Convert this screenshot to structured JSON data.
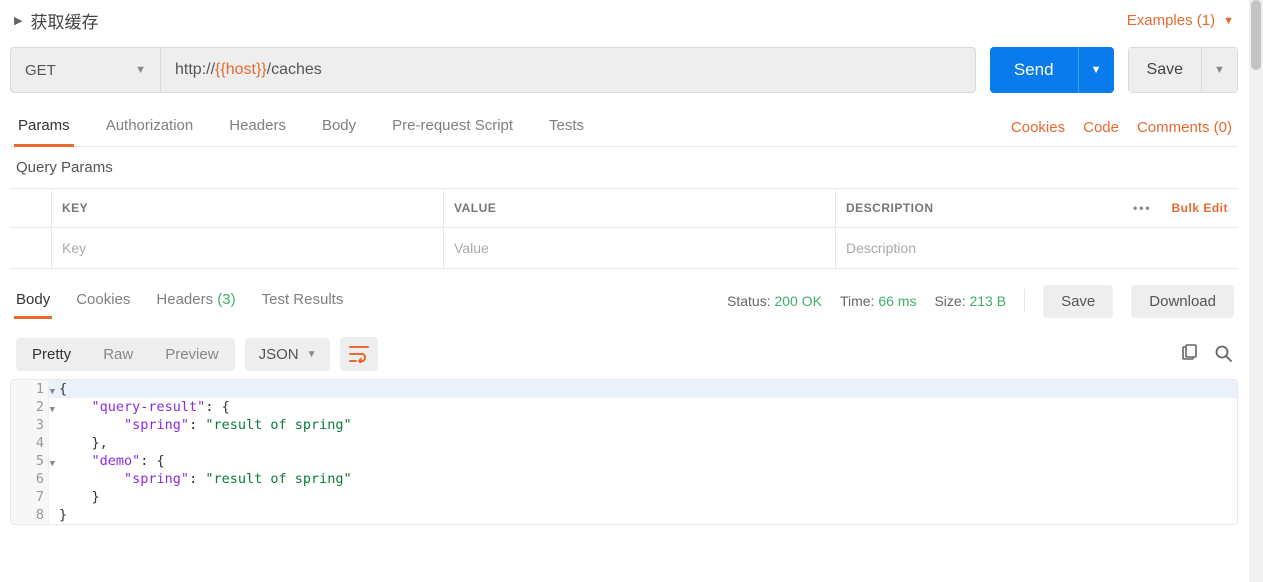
{
  "header": {
    "title": "获取缓存",
    "examples_label": "Examples (1)"
  },
  "request": {
    "method": "GET",
    "url_prefix": "http://",
    "url_var": "{{host}}",
    "url_suffix": "/caches",
    "send_label": "Send",
    "save_label": "Save"
  },
  "request_tabs": [
    "Params",
    "Authorization",
    "Headers",
    "Body",
    "Pre-request Script",
    "Tests"
  ],
  "request_tab_active": "Params",
  "request_links": {
    "cookies": "Cookies",
    "code": "Code",
    "comments": "Comments (0)"
  },
  "query_params": {
    "section_label": "Query Params",
    "headers": {
      "key": "KEY",
      "value": "VALUE",
      "description": "DESCRIPTION"
    },
    "placeholders": {
      "key": "Key",
      "value": "Value",
      "description": "Description"
    },
    "bulk_edit": "Bulk Edit"
  },
  "response_tabs": {
    "body": "Body",
    "cookies": "Cookies",
    "headers": "Headers",
    "headers_count": "(3)",
    "test_results": "Test Results"
  },
  "response_meta": {
    "status_label": "Status:",
    "status_value": "200 OK",
    "time_label": "Time:",
    "time_value": "66 ms",
    "size_label": "Size:",
    "size_value": "213 B",
    "save_label": "Save",
    "download_label": "Download"
  },
  "format": {
    "pretty": "Pretty",
    "raw": "Raw",
    "preview": "Preview",
    "lang": "JSON"
  },
  "body_lines": [
    {
      "n": 1,
      "fold": true,
      "indent": 0,
      "tokens": [
        "{"
      ]
    },
    {
      "n": 2,
      "fold": true,
      "indent": 1,
      "tokens": [
        "\"query-result\"",
        ":",
        " ",
        "{"
      ]
    },
    {
      "n": 3,
      "fold": false,
      "indent": 2,
      "tokens": [
        "\"spring\"",
        ":",
        " ",
        "\"result of spring\""
      ]
    },
    {
      "n": 4,
      "fold": false,
      "indent": 1,
      "tokens": [
        "}",
        ","
      ]
    },
    {
      "n": 5,
      "fold": true,
      "indent": 1,
      "tokens": [
        "\"demo\"",
        ":",
        " ",
        "{"
      ]
    },
    {
      "n": 6,
      "fold": false,
      "indent": 2,
      "tokens": [
        "\"spring\"",
        ":",
        " ",
        "\"result of spring\""
      ]
    },
    {
      "n": 7,
      "fold": false,
      "indent": 1,
      "tokens": [
        "}"
      ]
    },
    {
      "n": 8,
      "fold": false,
      "indent": 0,
      "tokens": [
        "}"
      ]
    }
  ]
}
